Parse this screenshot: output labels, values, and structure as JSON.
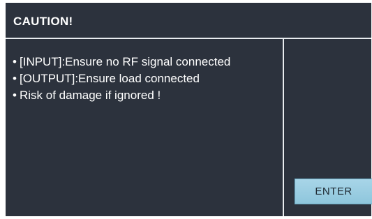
{
  "dialog": {
    "title": "CAUTION!",
    "bullet_glyph": "•",
    "messages": [
      "[INPUT]:Ensure no RF signal connected",
      "[OUTPUT]:Ensure load connected",
      "Risk of damage if ignored !"
    ],
    "enter_label": "ENTER"
  },
  "colors": {
    "background": "#2c323d",
    "text": "#ffffff",
    "divider": "#e9ecef",
    "button": "#9fd0e4"
  }
}
